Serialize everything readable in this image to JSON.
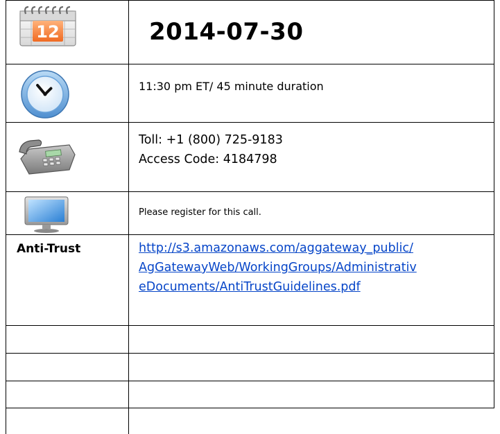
{
  "meeting": {
    "date": "2014-07-30",
    "calendar_day": "12",
    "time_text": "11:30 pm ET/ 45 minute duration",
    "toll_line": "Toll: +1 (800) 725-9183",
    "access_line": "Access Code: 4184798",
    "register_text": "Please register for this call.",
    "antitrust_label": "Anti-Trust",
    "antitrust_link_lines": [
      "http://s3.amazonaws.com/aggateway_public/",
      "AgGatewayWeb/WorkingGroups/Administrativ",
      "eDocuments/AntiTrustGuidelines.pdf"
    ]
  },
  "icons": [
    "calendar-icon",
    "clock-icon",
    "telephone-icon",
    "monitor-icon"
  ],
  "colors": {
    "link": "#0645c8",
    "border": "#000000"
  }
}
